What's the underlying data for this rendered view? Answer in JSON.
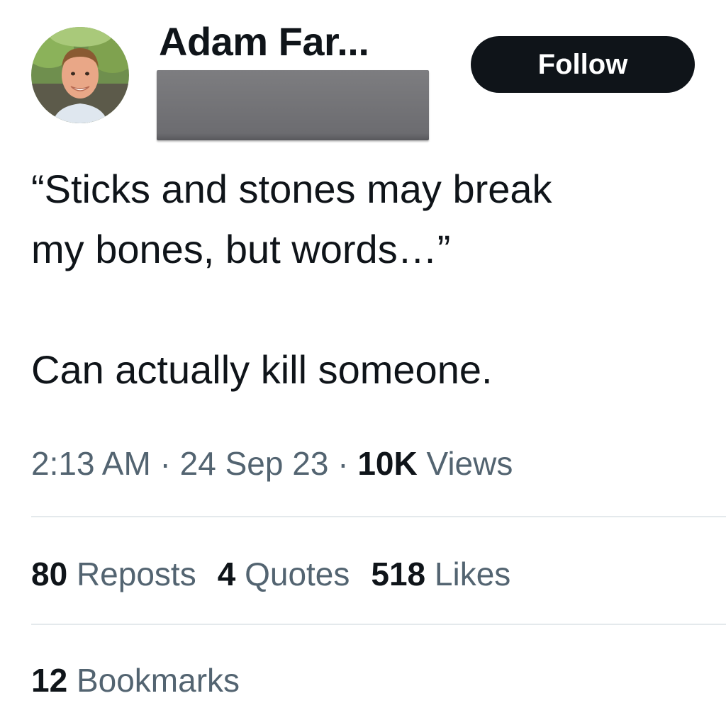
{
  "author": {
    "display_name": "Adam Far...",
    "avatar_icon": "profile-photo"
  },
  "follow_button": {
    "label": "Follow"
  },
  "tweet": {
    "lines": [
      "“Sticks and stones may break",
      "my bones, but words…”",
      "",
      "Can actually kill someone."
    ]
  },
  "meta": {
    "time": "2:13 AM",
    "separator": " · ",
    "date": "24 Sep 23",
    "views_count": "10K",
    "views_label": "Views"
  },
  "stats": {
    "reposts": {
      "count": "80",
      "label": "Reposts"
    },
    "quotes": {
      "count": "4",
      "label": "Quotes"
    },
    "likes": {
      "count": "518",
      "label": "Likes"
    },
    "bookmarks": {
      "count": "12",
      "label": "Bookmarks"
    }
  },
  "colors": {
    "text_primary": "#0f1419",
    "text_secondary": "#536471",
    "follow_bg": "#0f1419",
    "divider": "#e4e9ec",
    "redaction": "#737377"
  }
}
